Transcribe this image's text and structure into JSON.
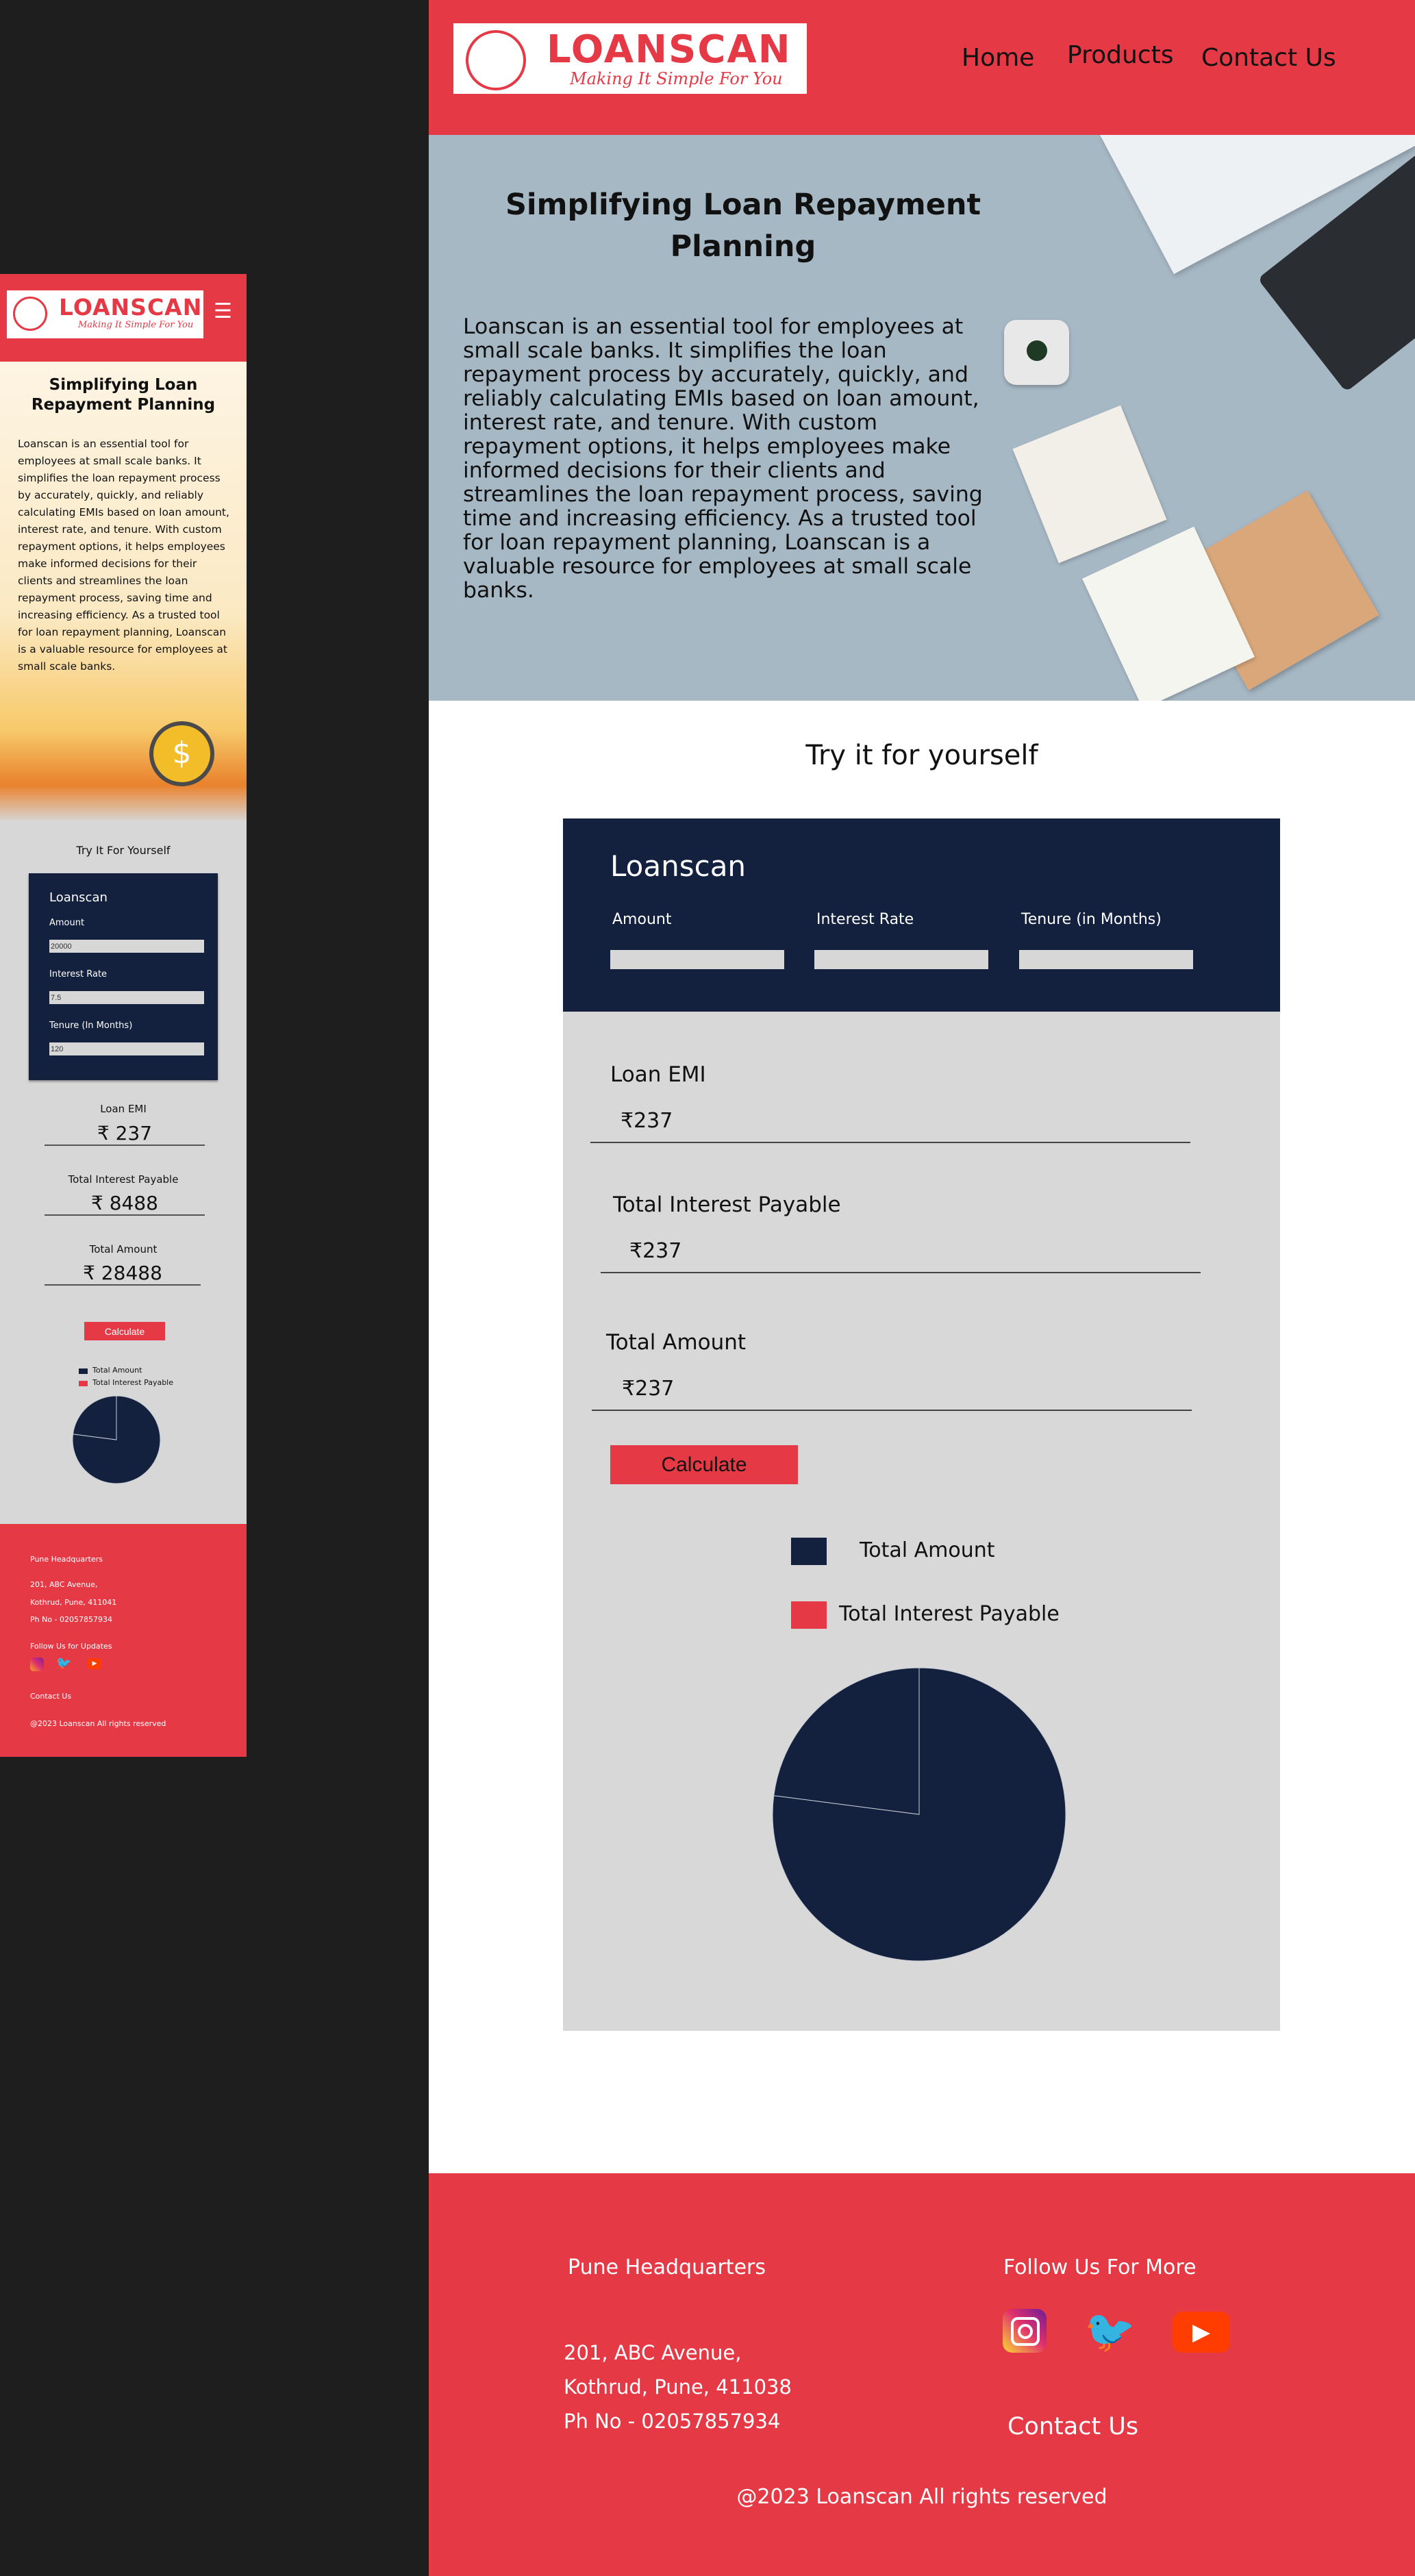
{
  "brand": {
    "name": "LOANSCAN",
    "tagline": "Making It Simple For You",
    "accent_color": "#e63946",
    "navy_color": "#13213e"
  },
  "nav": {
    "items": [
      "Home",
      "Products",
      "Contact Us"
    ],
    "menu_icon": "hamburger-menu-icon"
  },
  "hero": {
    "title": "Simplifying Loan Repayment Planning",
    "text": "Loanscan is an essential tool for employees at small scale banks. It simplifies the loan repayment process by accurately, quickly, and reliably calculating EMIs based on loan amount, interest rate, and tenure. With custom repayment options, it helps employees make informed decisions for their clients and streamlines the loan repayment process, saving time and increasing efficiency. As a trusted tool for loan repayment planning, Loanscan is a valuable resource for employees at small scale banks."
  },
  "mobile": {
    "try_heading": "Try It For Yourself",
    "calculator": {
      "title": "Loanscan",
      "fields": [
        {
          "label": "Amount",
          "value": "20000"
        },
        {
          "label": "Interest Rate",
          "value": "7.5"
        },
        {
          "label": "Tenure (In Months)",
          "value": "120"
        }
      ]
    },
    "results": [
      {
        "label": "Loan EMI",
        "value": "₹ 237"
      },
      {
        "label": "Total Interest Payable",
        "value": "₹ 8488"
      },
      {
        "label": "Total Amount",
        "value": "₹ 28488"
      }
    ],
    "calculate_label": "Calculate",
    "legend": [
      "Total Amount",
      "Total Interest Payable"
    ],
    "footer": {
      "hq_title": "Pune Headquarters",
      "address_lines": [
        "201, ABC Avenue,",
        "Kothrud, Pune, 411041",
        "Ph No - 02057857934"
      ],
      "follow": "Follow Us for Updates",
      "contact": "Contact Us",
      "copyright": "@2023 Loanscan All rights reserved"
    }
  },
  "desktop": {
    "try_heading": "Try it for yourself",
    "calculator": {
      "title": "Loanscan",
      "fields": [
        {
          "label": "Amount",
          "value": ""
        },
        {
          "label": "Interest Rate",
          "value": ""
        },
        {
          "label": "Tenure (in Months)",
          "value": ""
        }
      ]
    },
    "results": [
      {
        "label": "Loan EMI",
        "value": "₹237"
      },
      {
        "label": "Total Interest Payable",
        "value": "₹237"
      },
      {
        "label": "Total Amount",
        "value": "₹237"
      }
    ],
    "calculate_label": "Calculate",
    "legend": [
      "Total Amount",
      "Total Interest Payable"
    ],
    "footer": {
      "hq_title": "Pune Headquarters",
      "address_lines": [
        "201, ABC Avenue,",
        "Kothrud, Pune, 411038",
        "Ph No - 02057857934"
      ],
      "follow": "Follow Us For More",
      "contact": "Contact Us",
      "copyright": "@2023 Loanscan All rights reserved"
    }
  },
  "social_icons": [
    "instagram-icon",
    "twitter-icon",
    "youtube-icon"
  ],
  "chart_data": {
    "type": "pie",
    "labels": [
      "Total Amount",
      "Total Interest Payable"
    ],
    "values": [
      28488,
      8488
    ],
    "colors": [
      "#13213e",
      "#e63946"
    ]
  }
}
